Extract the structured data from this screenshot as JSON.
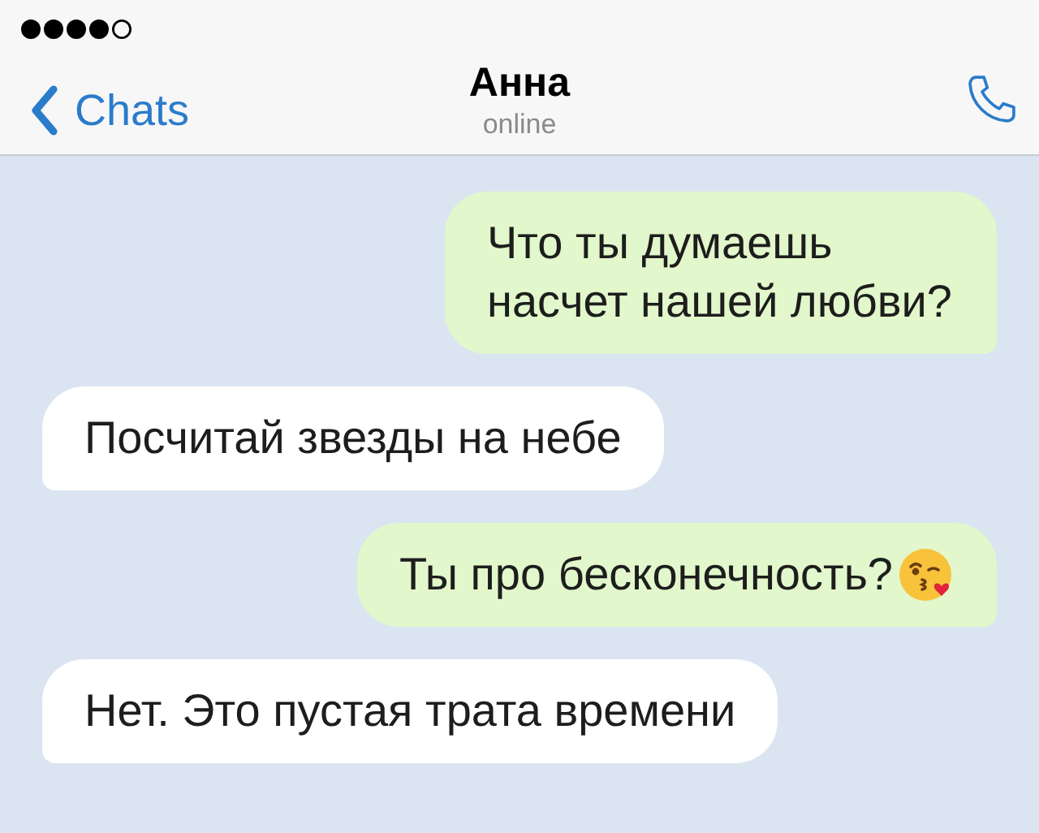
{
  "header": {
    "back_label": "Chats",
    "title": "Анна",
    "status": "online"
  },
  "messages": [
    {
      "kind": "outgoing",
      "text": "Что ты думаешь насчет нашей любви?",
      "emoji": false
    },
    {
      "kind": "incoming",
      "text": "Посчитай звезды на небе",
      "emoji": false
    },
    {
      "kind": "outgoing",
      "text": "Ты про бесконечность?",
      "emoji": true
    },
    {
      "kind": "incoming",
      "text": "Нет. Это пустая трата времени",
      "emoji": false
    }
  ]
}
